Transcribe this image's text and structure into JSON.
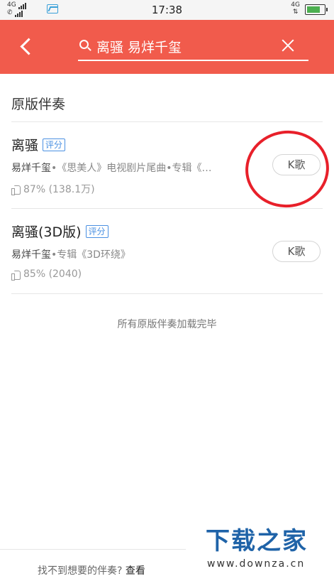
{
  "status_bar": {
    "net_top": "4G",
    "time": "17:38",
    "net_right": "4G"
  },
  "header": {
    "search_query": "离骚 易烊千玺"
  },
  "section": {
    "title": "原版伴奏"
  },
  "songs": [
    {
      "title": "离骚",
      "tag": "评分",
      "artist": "易烊千玺",
      "album_info": "•《思美人》电视剧片尾曲•专辑《…",
      "likes": "87% (138.1万)",
      "action": "K歌"
    },
    {
      "title": "离骚(3D版)",
      "tag": "评分",
      "artist": "易烊千玺",
      "album_info": "•专辑《3D环绕》",
      "likes": "85% (2040)",
      "action": "K歌"
    }
  ],
  "load_done": "所有原版伴奏加载完毕",
  "footer": {
    "prompt": "找不到想要的伴奏?",
    "link": "查看"
  },
  "watermark": {
    "title": "下载之家",
    "url": "www.downza.cn"
  },
  "colors": {
    "header_bg": "#f15b4c",
    "tag": "#4a90e2",
    "annotation": "#e8202a"
  }
}
